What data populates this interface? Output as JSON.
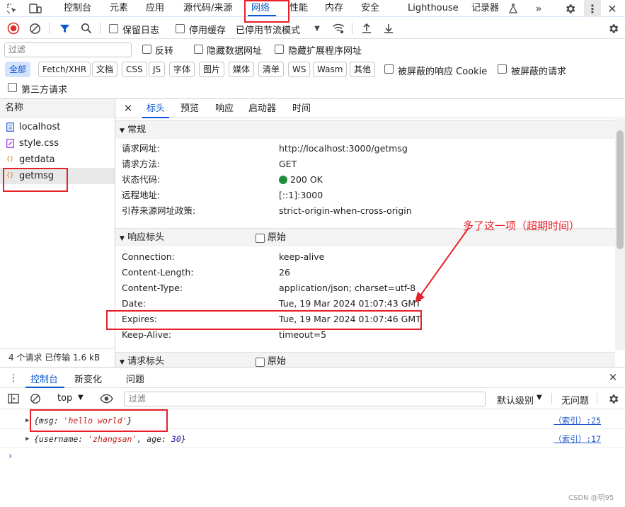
{
  "top_tabs": [
    "控制台",
    "元素",
    "应用",
    "源代码/来源",
    "网络",
    "性能",
    "内存",
    "安全",
    "Lighthouse",
    "记录器"
  ],
  "active_top_tab": "网络",
  "toolbar": {
    "preserve_log": "保留日志",
    "disable_cache": "停用缓存",
    "throttling": "已停用节流模式"
  },
  "filter": {
    "placeholder": "过滤",
    "invert": "反转",
    "hide_data_urls": "隐藏数据网址",
    "hide_extension_urls": "隐藏扩展程序网址"
  },
  "type_chips": [
    "全部",
    "Fetch/XHR",
    "文档",
    "CSS",
    "JS",
    "字体",
    "图片",
    "媒体",
    "清单",
    "WS",
    "Wasm",
    "其他"
  ],
  "blocked_cookies": "被屏蔽的响应 Cookie",
  "blocked_requests": "被屏蔽的请求",
  "third_party": "第三方请求",
  "list": {
    "header": "名称",
    "items": [
      {
        "name": "localhost",
        "type": "doc"
      },
      {
        "name": "style.css",
        "type": "css"
      },
      {
        "name": "getdata",
        "type": "xhr"
      },
      {
        "name": "getmsg",
        "type": "xhr"
      }
    ],
    "footer": "4 个请求    已传输 1.6 kB"
  },
  "detail_tabs": [
    "标头",
    "预览",
    "响应",
    "启动器",
    "时间"
  ],
  "general": {
    "title": "常规",
    "rows": [
      {
        "k": "请求网址:",
        "v": "http://localhost:3000/getmsg"
      },
      {
        "k": "请求方法:",
        "v": "GET"
      },
      {
        "k": "状态代码:",
        "v": "200 OK"
      },
      {
        "k": "远程地址:",
        "v": "[::1]:3000"
      },
      {
        "k": "引荐来源网址政策:",
        "v": "strict-origin-when-cross-origin"
      }
    ]
  },
  "response_headers": {
    "title": "响应标头",
    "raw": "原始",
    "rows": [
      {
        "k": "Connection:",
        "v": "keep-alive"
      },
      {
        "k": "Content-Length:",
        "v": "26"
      },
      {
        "k": "Content-Type:",
        "v": "application/json; charset=utf-8"
      },
      {
        "k": "Date:",
        "v": "Tue, 19 Mar 2024 01:07:43 GMT"
      },
      {
        "k": "Expires:",
        "v": "Tue, 19 Mar 2024 01:07:46 GMT"
      },
      {
        "k": "Keep-Alive:",
        "v": "timeout=5"
      }
    ]
  },
  "request_headers": {
    "title": "请求标头",
    "raw": "原始"
  },
  "annotation": "多了这一项（超期时间）",
  "drawer_tabs": [
    "控制台",
    "新变化",
    "问题"
  ],
  "console_toolbar": {
    "context": "top",
    "filter_placeholder": "过滤",
    "levels": "默认级别",
    "issues": "无问题"
  },
  "console_lines": [
    {
      "text": "{msg: 'hello world'}",
      "src": "（索引）:25"
    },
    {
      "text": "{username: 'zhangsan', age: 30}",
      "src": "（索引）:17"
    }
  ],
  "watermark": "CSDN @玥95",
  "colors": {
    "accent": "#0b57d0",
    "annotation": "#e8202a",
    "status_ok": "#1e8e3e"
  }
}
